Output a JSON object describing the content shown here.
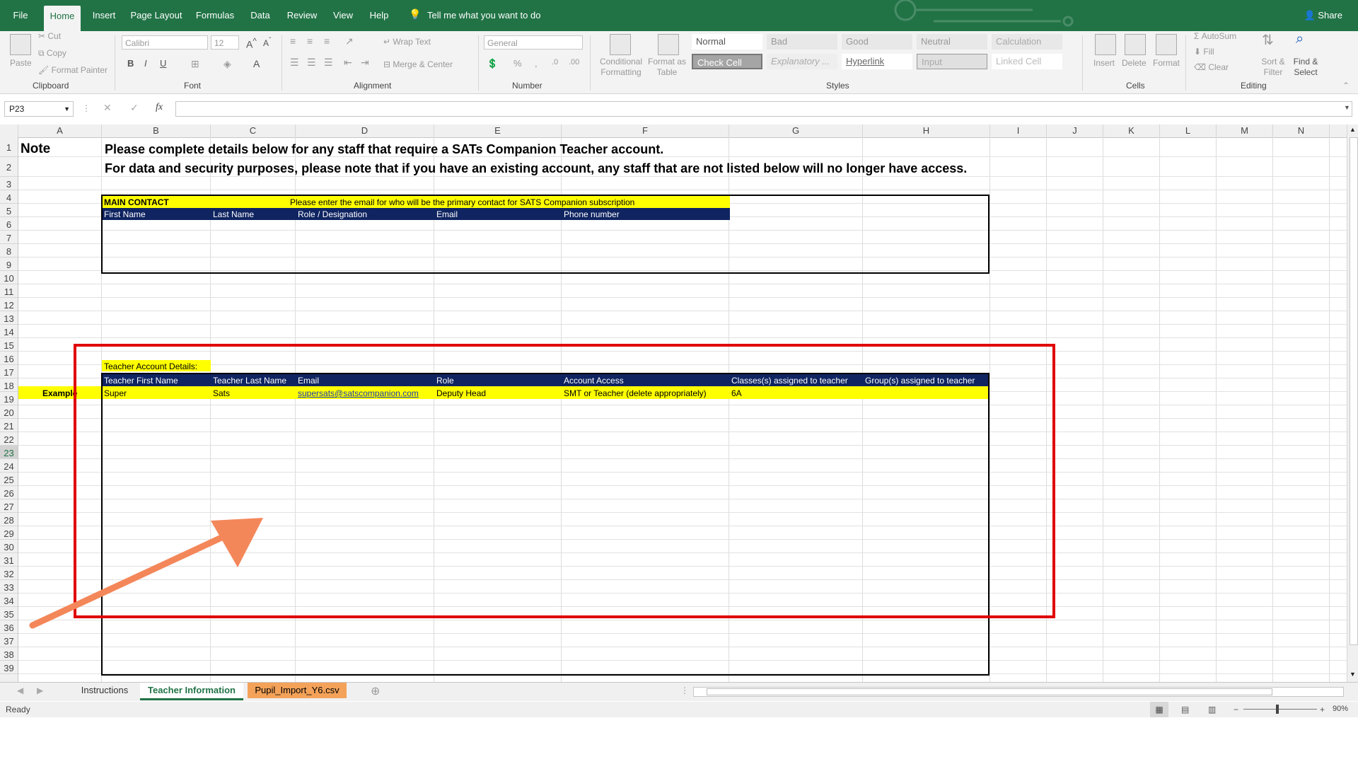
{
  "ribbon": {
    "tabs": [
      "File",
      "Home",
      "Insert",
      "Page Layout",
      "Formulas",
      "Data",
      "Review",
      "View",
      "Help"
    ],
    "active_tab": "Home",
    "tell_me": "Tell me what you want to do",
    "share": "Share",
    "clipboard": {
      "paste": "Paste",
      "cut": "Cut",
      "copy": "Copy",
      "format_painter": "Format Painter",
      "label": "Clipboard"
    },
    "font": {
      "name": "Calibri",
      "size": "12",
      "label": "Font"
    },
    "alignment": {
      "wrap": "Wrap Text",
      "merge": "Merge & Center",
      "label": "Alignment"
    },
    "number": {
      "format": "General",
      "label": "Number"
    },
    "styles": {
      "conditional": "Conditional Formatting",
      "format_table": "Format as Table",
      "label": "Styles",
      "cells": [
        "Normal",
        "Bad",
        "Good",
        "Neutral",
        "Calculation",
        "Check Cell",
        "Explanatory ...",
        "Hyperlink",
        "Input",
        "Linked Cell"
      ]
    },
    "cells_group": {
      "insert": "Insert",
      "delete": "Delete",
      "format": "Format",
      "label": "Cells"
    },
    "editing": {
      "autosum": "AutoSum",
      "fill": "Fill",
      "clear": "Clear",
      "sort": "Sort & Filter",
      "find": "Find & Select",
      "label": "Editing"
    }
  },
  "formula_bar": {
    "name_box": "P23",
    "fx": "fx",
    "value": ""
  },
  "columns": [
    "A",
    "B",
    "C",
    "D",
    "E",
    "F",
    "G",
    "H",
    "I",
    "J",
    "K",
    "L",
    "M",
    "N"
  ],
  "rows": [
    "1",
    "2",
    "3",
    "4",
    "5",
    "6",
    "7",
    "8",
    "9",
    "10",
    "11",
    "12",
    "13",
    "14",
    "15",
    "16",
    "17",
    "18",
    "19",
    "20",
    "21",
    "22",
    "23",
    "24",
    "25",
    "26",
    "27",
    "28",
    "29",
    "30",
    "31",
    "32",
    "33",
    "34",
    "35",
    "36",
    "37",
    "38",
    "39"
  ],
  "selected_row": "23",
  "sheet": {
    "note": "Note",
    "line1": "Please complete details below for any staff that require a SATs Companion Teacher account.",
    "line2": "For data and security purposes, please note that if you have an existing account, any staff that are not listed below will no longer have access.",
    "main_contact": {
      "title": "MAIN CONTACT",
      "instruction": "Please enter the email for who will be the primary contact for SATS Companion subscription",
      "headers": [
        "First Name",
        "Last Name",
        "Role / Designation",
        "Email",
        "Phone number"
      ]
    },
    "teacher": {
      "title": "Teacher Account Details:",
      "headers": [
        "Teacher First Name",
        "Teacher Last Name",
        "Email",
        "Role",
        "Account Access",
        "Classes(s) assigned to teacher",
        "Group(s) assigned to teacher"
      ],
      "example_label": "Example",
      "example": [
        "Super",
        "Sats",
        "supersats@satscompanion.com",
        "Deputy Head",
        "SMT or Teacher  (delete appropriately)",
        "6A",
        ""
      ]
    }
  },
  "sheet_tabs": [
    "Instructions",
    "Teacher Information",
    "Pupil_Import_Y6.csv"
  ],
  "active_sheet": "Teacher Information",
  "status": {
    "ready": "Ready",
    "zoom": "90%"
  },
  "colors": {
    "excel_green": "#217346",
    "annotation_red": "#e00000",
    "arrow_orange": "#f4875a",
    "navy": "#0f2461",
    "yellow": "#ffff00",
    "csv_tab": "#f4a259"
  }
}
